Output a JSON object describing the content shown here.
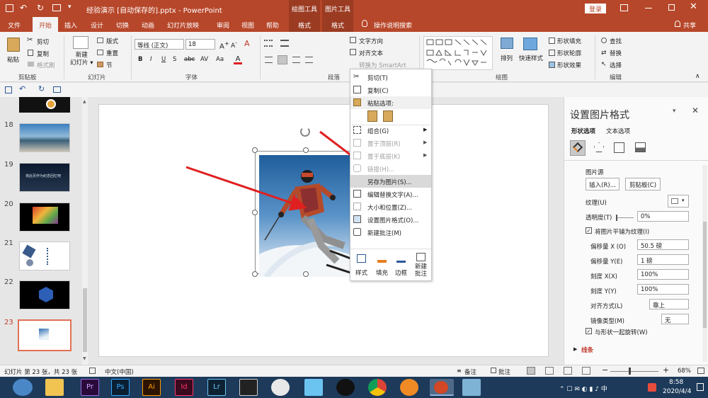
{
  "title": "经验演示 [自动保存的].pptx - PowerPoint",
  "context_tabs": [
    "绘图工具",
    "图片工具"
  ],
  "login": "登录",
  "share": "共享",
  "tabs": [
    "文件",
    "开始",
    "插入",
    "设计",
    "切换",
    "动画",
    "幻灯片放映",
    "审阅",
    "视图",
    "帮助",
    "格式",
    "格式"
  ],
  "tell_me": "操作说明搜索",
  "ribbon": {
    "paste": "粘贴",
    "cut": "剪切",
    "copy": "复制",
    "format_painter": "格式刷",
    "clipboard": "剪贴板",
    "new_slide": "新建\n幻灯片",
    "layout": "版式",
    "reset": "重置",
    "section": "节",
    "slides_group": "幻灯片",
    "font_name": "等线 (正文)",
    "font_size": "18",
    "font_group": "字体",
    "paragraph_group": "段落",
    "text_direction": "文字方向",
    "align_text": "对齐文本",
    "smartart": "转换为 SmartArt",
    "arrange": "排列",
    "quick_styles": "快速样式",
    "shape_fill": "形状填充",
    "shape_outline": "形状轮廓",
    "shape_effects": "形状效果",
    "drawing_group": "绘图",
    "find": "查找",
    "replace": "替换",
    "select": "选择",
    "editing_group": "编辑"
  },
  "slides": [
    {
      "n": "18"
    },
    {
      "n": "19"
    },
    {
      "n": "20"
    },
    {
      "n": "21"
    },
    {
      "n": "22"
    },
    {
      "n": "23"
    }
  ],
  "thumb_19_text": "将此页作为纪念回忆吧",
  "context_menu": {
    "items": [
      {
        "label": "剪切(T)",
        "state": "normal",
        "icon": "scissors-icon"
      },
      {
        "label": "复制(C)",
        "state": "normal",
        "icon": "copy-icon"
      },
      {
        "label": "粘贴选项:",
        "state": "header",
        "icon": "paste-icon"
      },
      {
        "label": "组合(G)",
        "state": "sub",
        "icon": "group-icon"
      },
      {
        "label": "置于顶层(R)",
        "state": "disabled-sub",
        "icon": "bring-front-icon"
      },
      {
        "label": "置于底层(K)",
        "state": "disabled-sub",
        "icon": "send-back-icon"
      },
      {
        "label": "链接(H)...",
        "state": "disabled",
        "icon": "link-icon"
      },
      {
        "label": "另存为图片(S)...",
        "state": "highlight",
        "icon": ""
      },
      {
        "label": "编辑替换文字(A)...",
        "state": "normal",
        "icon": "alt-text-icon"
      },
      {
        "label": "大小和位置(Z)...",
        "state": "normal",
        "icon": "size-icon"
      },
      {
        "label": "设置图片格式(O)...",
        "state": "normal",
        "icon": "format-picture-icon"
      },
      {
        "label": "新建批注(M)",
        "state": "normal",
        "icon": "comment-icon"
      }
    ],
    "mini": [
      "样式",
      "填充",
      "边框",
      "新建\n批注"
    ]
  },
  "pane": {
    "title": "设置图片格式",
    "tabs": [
      "形状选项",
      "文本选项"
    ],
    "section": "图片源",
    "insert_btn": "插入(R)...",
    "clipboard_btn": "剪贴板(C)",
    "texture": "纹理(U)",
    "transparency_label": "透明度(T)",
    "transparency": "0%",
    "tile_label": "将图片平铺为纹理(I)",
    "offset_x_label": "偏移量 X (O)",
    "offset_x": "50.5 磅",
    "offset_y_label": "偏移量 Y(E)",
    "offset_y": "1 磅",
    "scale_x_label": "刻度 X(X)",
    "scale_x": "100%",
    "scale_y_label": "刻度 Y(Y)",
    "scale_y": "100%",
    "align_label": "对齐方式(L)",
    "align": "靠上",
    "mirror_label": "镜像类型(M)",
    "mirror": "无",
    "rotate_label": "与形状一起旋转(W)",
    "line_section": "线条"
  },
  "status": {
    "slide_info": "幻灯片 第 23 张，共 23 张",
    "language": "中文(中国)",
    "notes": "备注",
    "comments": "批注",
    "zoom": "68%"
  },
  "clock": {
    "time": "8:58",
    "date": "2020/4/4"
  },
  "colors": {
    "accent": "#b7472a",
    "arrow": "#e02020"
  }
}
